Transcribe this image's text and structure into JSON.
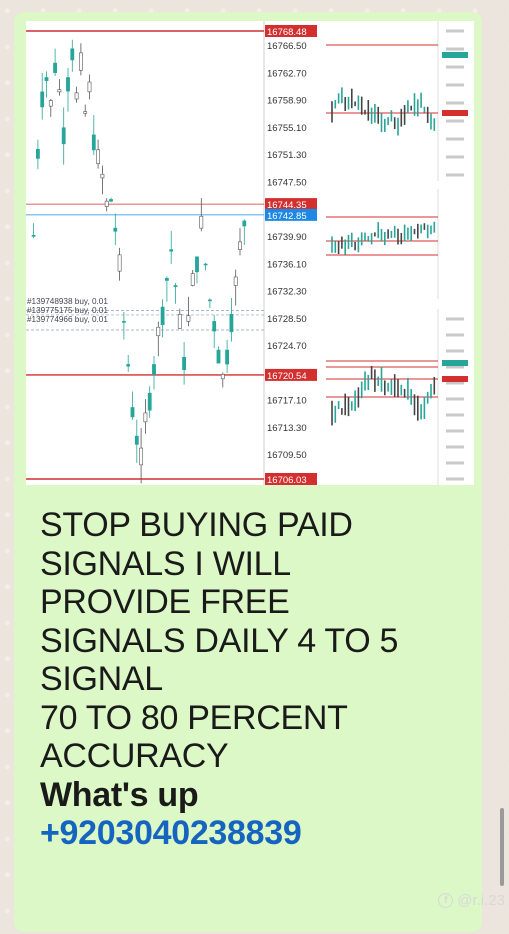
{
  "main_chart": {
    "price_labels": [
      "16766.50",
      "16762.70",
      "16758.90",
      "16755.10",
      "16751.30",
      "16747.50",
      "16739.90",
      "16736.10",
      "16732.30",
      "16728.50",
      "16724.70",
      "16717.10",
      "16713.30",
      "16709.50"
    ],
    "highlight_labels": {
      "top": "16768.48",
      "bid": "16744.35",
      "ask": "16742.85",
      "mid": "16720.54",
      "bottom": "16706.03"
    },
    "orders": [
      "#139748938 buy, 0.01",
      "#139775175 buy, 0.01",
      "#139774966 buy, 0.01"
    ],
    "colors": {
      "up": "#26a69a",
      "level": "#d32f2f",
      "bid": "#1e88e5"
    }
  },
  "message": {
    "lines": [
      "STOP BUYING PAID",
      "SIGNALS I WILL",
      "PROVIDE FREE",
      "SIGNALS DAILY 4 TO 5",
      "SIGNAL",
      "70 TO 80 PERCENT",
      "ACCURACY"
    ],
    "whatsapp_label": "What's up",
    "phone": "+9203040238839"
  },
  "watermark": {
    "text": "@r.i.23",
    "icon": "facebook-icon"
  },
  "colors": {
    "bubble": "#dcf8c6",
    "background": "#ece5dd",
    "phone": "#1565c0"
  }
}
